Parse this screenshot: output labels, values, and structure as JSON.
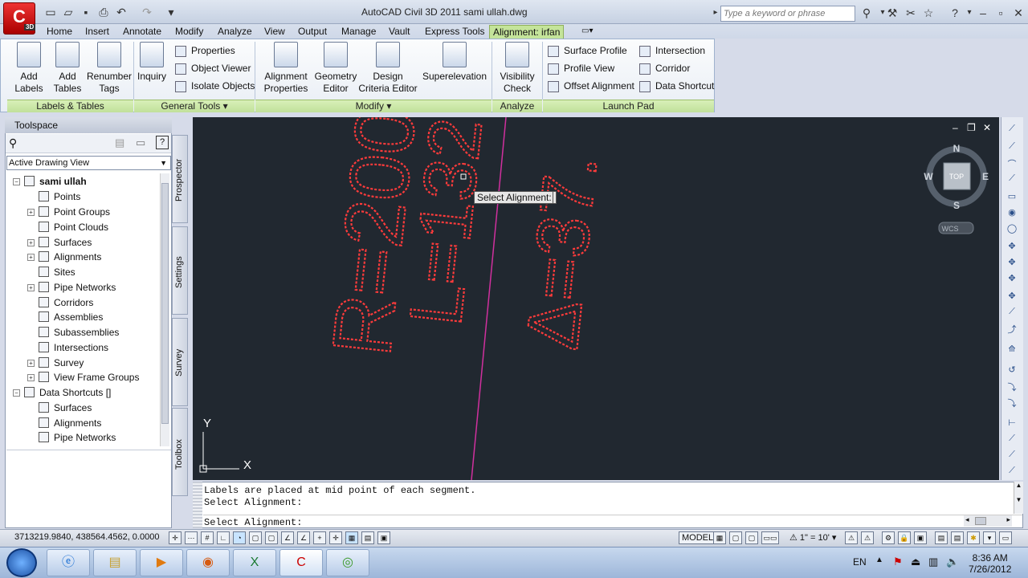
{
  "window": {
    "title": "AutoCAD Civil 3D 2011     sami ullah.dwg",
    "search_placeholder": "Type a keyword or phrase",
    "app_button": "C",
    "app_badge": "3D"
  },
  "tabs": [
    "Home",
    "Insert",
    "Annotate",
    "Modify",
    "Analyze",
    "View",
    "Output",
    "Manage",
    "Vault",
    "Express Tools",
    "Alignment: irfan"
  ],
  "ribbon": {
    "labels_tables": {
      "title": "Labels & Tables",
      "buttons": [
        [
          "Add",
          "Labels"
        ],
        [
          "Add",
          "Tables"
        ],
        [
          "Renumber",
          "Tags"
        ]
      ]
    },
    "general_tools": {
      "title": "General Tools",
      "inquiry": "Inquiry",
      "items": [
        "Properties",
        "Object Viewer",
        "Isolate Objects"
      ]
    },
    "modify": {
      "title": "Modify",
      "buttons": [
        [
          "Alignment",
          "Properties"
        ],
        [
          "Geometry",
          "Editor"
        ],
        [
          "Design",
          "Criteria Editor"
        ],
        [
          "Superelevation",
          ""
        ]
      ]
    },
    "analyze": {
      "title": "Analyze",
      "buttons": [
        [
          "Visibility",
          "Check"
        ]
      ]
    },
    "launch_pad": {
      "title": "Launch Pad",
      "col1": [
        "Surface Profile",
        "Profile View",
        "Offset Alignment"
      ],
      "col2": [
        "Intersection",
        "Corridor",
        "Data Shortcut"
      ]
    }
  },
  "toolspace": {
    "title": "Toolspace",
    "view_select": "Active Drawing View",
    "drawing": "sami ullah",
    "items": [
      "Points",
      "Point Groups",
      "Point Clouds",
      "Surfaces",
      "Alignments",
      "Sites",
      "Pipe Networks",
      "Corridors",
      "Assemblies",
      "Subassemblies",
      "Intersections",
      "Survey",
      "View Frame Groups"
    ],
    "shortcuts": "Data Shortcuts []",
    "shortcut_items": [
      "Surfaces",
      "Alignments",
      "Pipe Networks"
    ],
    "vtabs": [
      "Prospector",
      "Settings",
      "Survey",
      "Toolbox"
    ]
  },
  "canvas": {
    "tooltip": "Select Alignment:",
    "compass": {
      "n": "N",
      "s": "S",
      "e": "E",
      "w": "W",
      "top": "TOP",
      "wcs": "WCS"
    },
    "ucs": {
      "x": "X",
      "y": "Y"
    },
    "text_r": "R=200",
    "text_l": "L=132",
    "text_d": "Δ=37."
  },
  "command": {
    "lines": [
      "Labels are placed at mid point of each segment.",
      "Select Alignment:"
    ],
    "prompt": "Select Alignment:"
  },
  "status": {
    "coords": "3713219.9840, 438564.4562, 0.0000",
    "model": "MODEL",
    "scale": "1\" = 10'"
  },
  "tray": {
    "lang": "EN",
    "time": "8:36 AM",
    "date": "7/26/2012"
  },
  "colors": {
    "ribbon_green": "#c4e49a",
    "canvas_bg": "#212830",
    "label_red": "#ff3b3b",
    "alignment_magenta": "#d0309e"
  }
}
